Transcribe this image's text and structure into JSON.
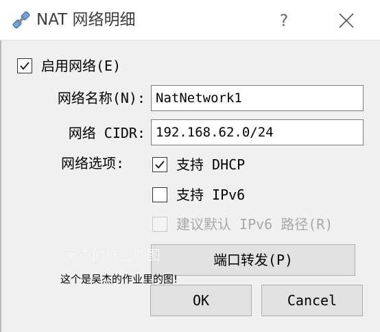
{
  "window": {
    "title": "NAT 网络明细",
    "help_label": "?",
    "icons": {
      "title": "network-icon",
      "close": "close-icon"
    }
  },
  "enable_network": {
    "label": "启用网络(E)",
    "checked": true
  },
  "network_name": {
    "label": "网络名称(N):",
    "value": "NatNetwork1"
  },
  "network_cidr": {
    "label": "网络 CIDR:",
    "value": "192.168.62.0/24"
  },
  "network_options": {
    "label": "网络选项:",
    "dhcp": {
      "label": "支持 DHCP",
      "checked": true
    },
    "ipv6": {
      "label": "支持 IPv6",
      "checked": false
    },
    "ipv6_default_route": {
      "label": "建议默认 IPv6 路径(R)",
      "checked": false,
      "enabled": false
    }
  },
  "port_forwarding_button": "端口转发(P)",
  "watermark_text": "吴杰的作业的图",
  "caption_text": "这个是吴杰的作业里的图!",
  "buttons": {
    "ok": "OK",
    "cancel": "Cancel"
  }
}
